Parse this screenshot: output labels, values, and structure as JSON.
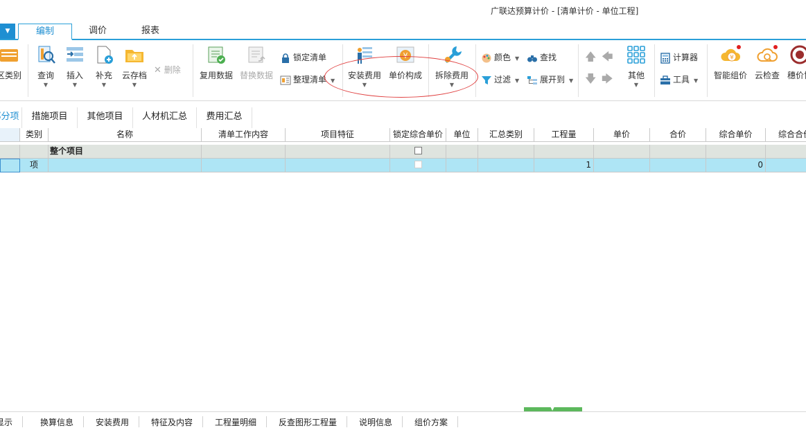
{
  "window": {
    "title": "广联达预算计价 - [清单计价 - 单位工程]"
  },
  "menu": {
    "dropdown_icon": "caret-down",
    "tabs": [
      {
        "label": "编制",
        "active": true
      },
      {
        "label": "调价",
        "active": false
      },
      {
        "label": "报表",
        "active": false
      }
    ]
  },
  "toolbar": {
    "partition_label": "区类别",
    "query_label": "查询",
    "insert_label": "插入",
    "supplement_label": "补充",
    "cloud_label": "云存档",
    "delete_label": "删除",
    "reuse_label": "复用数据",
    "replace_label": "替换数据",
    "lock_label": "锁定清单",
    "organize_label": "整理清单",
    "install_fee_label": "安装费用",
    "unit_price_label": "单价构成",
    "remove_fee_label": "拆除费用",
    "color_label": "颜色",
    "find_label": "查找",
    "filter_label": "过滤",
    "expand_label": "展开到",
    "other_label": "其他",
    "calculator_label": "计算器",
    "tools_label": "工具",
    "smart_price_label": "智能组价",
    "cloud_check_label": "云检查",
    "sui_label": "穗价协"
  },
  "subtabs": [
    {
      "label": "分部分项",
      "active": true
    },
    {
      "label": "措施项目",
      "active": false
    },
    {
      "label": "其他项目",
      "active": false
    },
    {
      "label": "人材机汇总",
      "active": false
    },
    {
      "label": "费用汇总",
      "active": false
    }
  ],
  "table": {
    "headers": [
      "类别",
      "名称",
      "清单工作内容",
      "项目特征",
      "锁定综合单价",
      "单位",
      "汇总类别",
      "工程量",
      "单价",
      "合价",
      "综合单价",
      "综合合价"
    ],
    "rows": [
      {
        "type": "",
        "name": "整个项目",
        "locked": false,
        "quantity": "",
        "composite_price": ""
      },
      {
        "type": "项",
        "name": "",
        "locked": false,
        "quantity": "1",
        "composite_price": "0"
      }
    ]
  },
  "bottom_tabs": [
    "工料机显示",
    "换算信息",
    "安装费用",
    "特征及内容",
    "工程量明细",
    "反查图形工程量",
    "说明信息",
    "组价方案"
  ],
  "colors": {
    "accent": "#1e8fd2",
    "row_selected": "#aee5f5",
    "row_group": "#dfe4df",
    "annotation": "#e04040"
  }
}
